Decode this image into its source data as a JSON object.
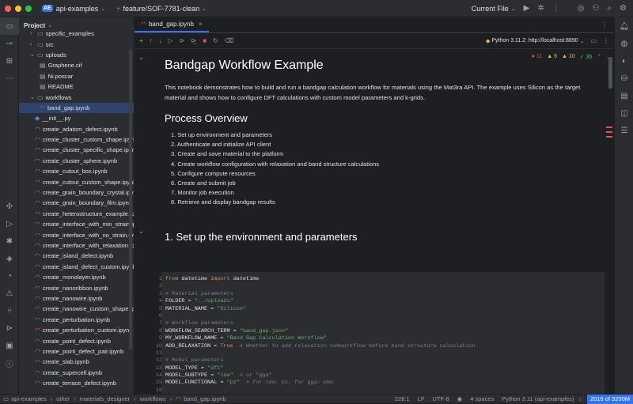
{
  "titlebar": {
    "project_badge": "AE",
    "project_name": "api-examples",
    "branch": "feature/SOF-7781-clean",
    "run_config": "Current File"
  },
  "project_panel": {
    "title": "Project"
  },
  "tree": [
    {
      "label": "specific_examples",
      "indent": 1,
      "kind": "folder",
      "expander": "›"
    },
    {
      "label": "src",
      "indent": 1,
      "kind": "folder",
      "expander": "›"
    },
    {
      "label": "uploads",
      "indent": 1,
      "kind": "folder",
      "expander": "⌄"
    },
    {
      "label": "Graphene.cif",
      "indent": 3,
      "kind": "file"
    },
    {
      "label": "Ni.poscar",
      "indent": 3,
      "kind": "file"
    },
    {
      "label": "README",
      "indent": 3,
      "kind": "file"
    },
    {
      "label": "workflows",
      "indent": 1,
      "kind": "folder",
      "expander": "⌄"
    },
    {
      "label": "band_gap.ipynb",
      "indent": 3,
      "kind": "nb",
      "selected": true
    },
    {
      "label": "__init__.py",
      "indent": 2,
      "kind": "py"
    },
    {
      "label": "create_adatom_defect.ipynb",
      "indent": 2,
      "kind": "nb"
    },
    {
      "label": "create_cluster_custom_shape.ipynb",
      "indent": 2,
      "kind": "nb"
    },
    {
      "label": "create_cluster_specific_shape.ipynb",
      "indent": 2,
      "kind": "nb"
    },
    {
      "label": "create_cluster_sphere.ipynb",
      "indent": 2,
      "kind": "nb"
    },
    {
      "label": "create_cutout_box.ipynb",
      "indent": 2,
      "kind": "nb"
    },
    {
      "label": "create_cutout_custom_shape.ipynb",
      "indent": 2,
      "kind": "nb"
    },
    {
      "label": "create_grain_boundary_crystal.ipynb",
      "indent": 2,
      "kind": "nb"
    },
    {
      "label": "create_grain_boundary_film.ipynb",
      "indent": 2,
      "kind": "nb"
    },
    {
      "label": "create_heterostructure_example.ipynb",
      "indent": 2,
      "kind": "nb"
    },
    {
      "label": "create_interface_with_min_strain.ipynb",
      "indent": 2,
      "kind": "nb"
    },
    {
      "label": "create_interface_with_no_strain.ipynb",
      "indent": 2,
      "kind": "nb"
    },
    {
      "label": "create_interface_with_relaxation.ipynb",
      "indent": 2,
      "kind": "nb"
    },
    {
      "label": "create_island_defect.ipynb",
      "indent": 2,
      "kind": "nb"
    },
    {
      "label": "create_island_defect_custom.ipynb",
      "indent": 2,
      "kind": "nb"
    },
    {
      "label": "create_monolayer.ipynb",
      "indent": 2,
      "kind": "nb"
    },
    {
      "label": "create_nanoribbon.ipynb",
      "indent": 2,
      "kind": "nb"
    },
    {
      "label": "create_nanowire.ipynb",
      "indent": 2,
      "kind": "nb"
    },
    {
      "label": "create_nanowire_custom_shape.ipynb",
      "indent": 2,
      "kind": "nb"
    },
    {
      "label": "create_perturbation.ipynb",
      "indent": 2,
      "kind": "nb"
    },
    {
      "label": "create_perturbation_custom.ipynb",
      "indent": 2,
      "kind": "nb"
    },
    {
      "label": "create_point_defect.ipynb",
      "indent": 2,
      "kind": "nb"
    },
    {
      "label": "create_point_defect_pair.ipynb",
      "indent": 2,
      "kind": "nb"
    },
    {
      "label": "create_slab.ipynb",
      "indent": 2,
      "kind": "nb"
    },
    {
      "label": "create_supercell.ipynb",
      "indent": 2,
      "kind": "nb"
    },
    {
      "label": "create_terrace_defect.ipynb",
      "indent": 2,
      "kind": "nb"
    }
  ],
  "editor": {
    "tab_label": "band_gap.ipynb",
    "kernel": "Python 3.11.2: http://localhost:8890",
    "inspections": {
      "errors": "11",
      "warnings": "5",
      "weak": "10",
      "typos": "35"
    }
  },
  "notebook": {
    "title": "Bandgap Workflow Example",
    "intro": "This notebook demonstrates how to build and run a bandgap calculation workflow for materials using the Mat3ra API. The example uses Silicon as the target material and shows how to configure DFT calculations with custom model parameters and k-grids.",
    "overview_heading": "Process Overview",
    "steps": [
      "1. Set up environment and parameters",
      "2. Authenticate and initialize API client",
      "3. Create and save material to the platform",
      "4. Create workflow configuration with relaxation and band structure calculations",
      "5. Configure compute resources",
      "6. Create and submit job",
      "7. Monitor job execution",
      "8. Retrieve and display bandgap results"
    ],
    "section1_heading": "1. Set up the environment and parameters"
  },
  "code_lines": [
    [
      {
        "t": "from ",
        "c": "kw"
      },
      {
        "t": "datetime "
      },
      {
        "t": "import ",
        "c": "kw"
      },
      {
        "t": "datetime"
      }
    ],
    [],
    [
      {
        "t": "# Material parameters",
        "c": "cm"
      }
    ],
    [
      {
        "t": "FOLDER = "
      },
      {
        "t": "\"../uploads\"",
        "c": "str"
      }
    ],
    [
      {
        "t": "MATERIAL_NAME = "
      },
      {
        "t": "\"Silicon\"",
        "c": "str"
      }
    ],
    [],
    [
      {
        "t": "# Workflow parameters",
        "c": "cm"
      }
    ],
    [
      {
        "t": "WORKFLOW_SEARCH_TERM = "
      },
      {
        "t": "\"band_gap.json\"",
        "c": "str"
      }
    ],
    [
      {
        "t": "MY_WORKFLOW_NAME = "
      },
      {
        "t": "\"Band Gap Calculation Workflow\"",
        "c": "str"
      }
    ],
    [
      {
        "t": "ADD_RELAXATION = "
      },
      {
        "t": "True",
        "c": "kw"
      },
      {
        "t": "  # Whether to add relaxation subworkflow before band structure calculation",
        "c": "cm"
      }
    ],
    [],
    [
      {
        "t": "# Model parameters",
        "c": "cm"
      }
    ],
    [
      {
        "t": "MODEL_TYPE = "
      },
      {
        "t": "\"dft\"",
        "c": "str"
      }
    ],
    [
      {
        "t": "MODEL_SUBTYPE = "
      },
      {
        "t": "\"lda\"",
        "c": "str"
      },
      {
        "t": "  # or \"gga\"",
        "c": "cm"
      }
    ],
    [
      {
        "t": "MODEL_FUNCTIONAL = "
      },
      {
        "t": "\"pz\"",
        "c": "str"
      },
      {
        "t": "  # for lda: pz, for gga: pbe",
        "c": "cm"
      }
    ],
    [],
    [
      {
        "t": "# K-grid parameters",
        "c": "cm"
      }
    ],
    [
      {
        "t": "RELAXATION_KGRID = ["
      },
      {
        "t": "1",
        "c": "num"
      },
      {
        "t": ", "
      },
      {
        "t": "1",
        "c": "num"
      },
      {
        "t": ", "
      },
      {
        "t": "1",
        "c": "num"
      },
      {
        "t": "]  # k-grid for relaxation",
        "c": "cm"
      }
    ]
  ],
  "statusbar": {
    "breadcrumb": [
      "api-examples",
      "other",
      "materials_designer",
      "workflows",
      "band_gap.ipynb"
    ],
    "position": "228:1",
    "line_sep": "LF",
    "encoding": "UTF-8",
    "indent": "4 spaces",
    "interpreter": "Python 3.11 (api-examples)",
    "memory": "2016 of 3200M"
  }
}
